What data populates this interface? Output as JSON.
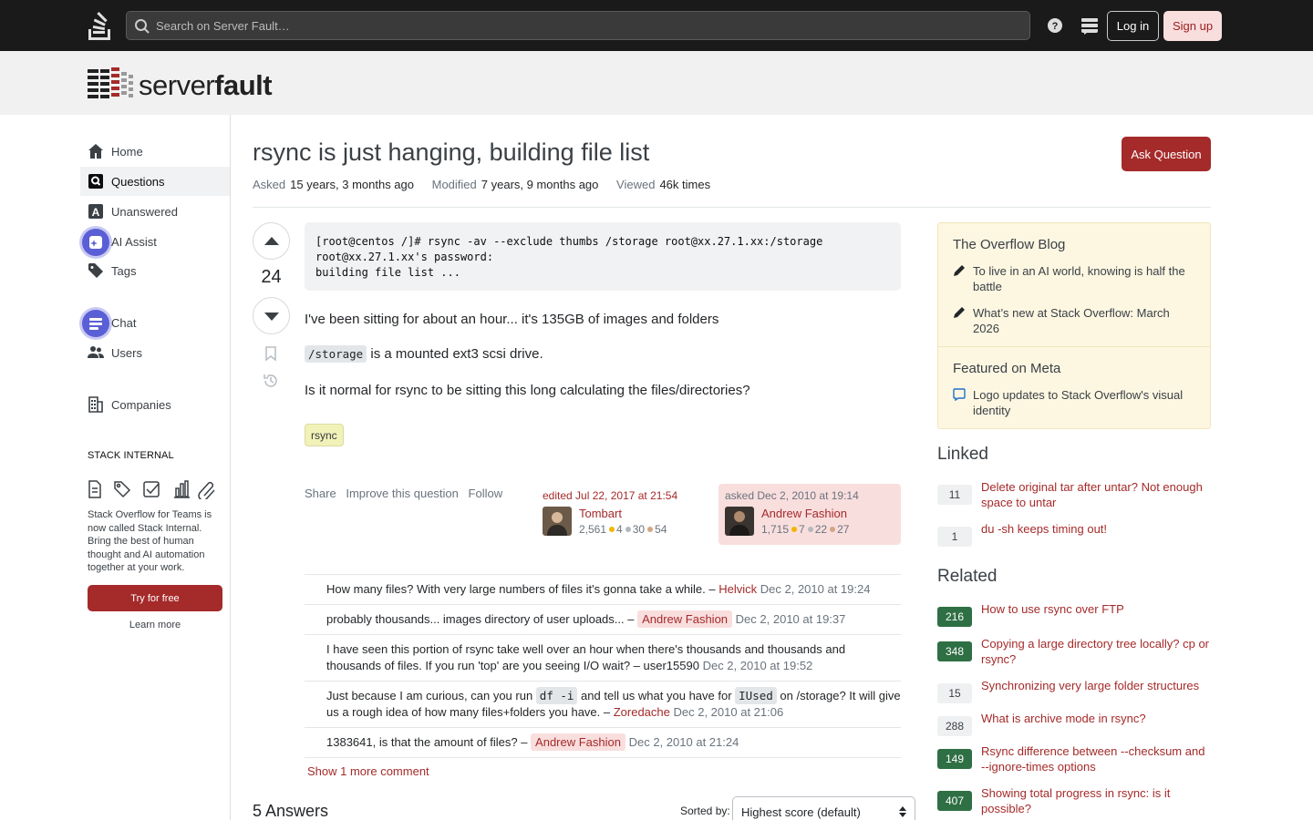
{
  "topbar": {
    "search_placeholder": "Search on Server Fault…",
    "login_label": "Log in",
    "signup_label": "Sign up",
    "icons": [
      "stackoverflow-logo-icon",
      "search-icon",
      "help-icon",
      "site-switcher-icon"
    ]
  },
  "brand": {
    "name_light": "server",
    "name_bold": "fault"
  },
  "nav": {
    "items": [
      {
        "label": "Home",
        "icon": "home-icon"
      },
      {
        "label": "Questions",
        "icon": "questions-icon",
        "active": true
      },
      {
        "label": "Unanswered",
        "icon": "unanswered-icon"
      },
      {
        "label": "AI Assist",
        "icon": "ai-assist-icon"
      },
      {
        "label": "Tags",
        "icon": "tag-icon"
      },
      {
        "label": "Chat",
        "icon": "chat-icon"
      },
      {
        "label": "Users",
        "icon": "users-icon"
      },
      {
        "label": "Companies",
        "icon": "companies-icon"
      }
    ],
    "stack_internal": {
      "heading": "STACK INTERNAL",
      "text": "Stack Overflow for Teams is now called Stack Internal. Bring the best of human thought and AI automation together at your work.",
      "try_label": "Try for free",
      "learn_more": "Learn more"
    }
  },
  "question": {
    "title": "rsync is just hanging, building file list",
    "ask_label": "Ask Question",
    "meta": {
      "asked_label": "Asked",
      "asked_value": "15 years, 3 months ago",
      "modified_label": "Modified",
      "modified_value": "7 years, 9 months ago",
      "viewed_label": "Viewed",
      "viewed_value": "46k times"
    },
    "score": "24",
    "code": "[root@centos /]# rsync -av --exclude thumbs /storage root@xx.27.1.xx:/storage\nroot@xx.27.1.xx's password:\nbuilding file list ...",
    "p1": "I've been sitting for about an hour... it's 135GB of images and folders",
    "p2_code": "/storage",
    "p2_text": " is a mounted ext3 scsi drive.",
    "p3": "Is it normal for rsync to be sitting this long calculating the files/directories?",
    "tag": "rsync",
    "actions": {
      "share": "Share",
      "improve": "Improve this question",
      "follow": "Follow"
    },
    "editor": {
      "title": "edited Jul 22, 2017 at 21:54",
      "name": "Tombart",
      "rep": "2,561",
      "gold": "4",
      "silver": "30",
      "bronze": "54"
    },
    "asker": {
      "title": "asked Dec 2, 2010 at 19:14",
      "name": "Andrew Fashion",
      "rep": "1,715",
      "gold": "7",
      "silver": "22",
      "bronze": "27"
    }
  },
  "comments": [
    {
      "text": "How many files? With very large numbers of files it's gonna take a while. – ",
      "user": "Helvick",
      "date": "Dec 2, 2010 at 19:24"
    },
    {
      "text": "probably thousands... images directory of user uploads... – ",
      "user": "Andrew Fashion",
      "date": "Dec 2, 2010 at 19:37"
    },
    {
      "text": "I have seen this portion of rsync take well over an hour when there's thousands and thousands and thousands of files. If you run 'top' are you seeing I/O wait? – ",
      "user": "user15590",
      "date": "Dec 2, 2010 at 19:52"
    },
    {
      "text_a": "Just because I am curious, can you run ",
      "code_a": "df -i",
      "text_b": " and tell us what you have for ",
      "code_b": "IUsed",
      "text_c": " on /storage? It will give us a rough idea of how many files+folders you have. – ",
      "user": "Zoredache",
      "date": "Dec 2, 2010 at 21:06"
    },
    {
      "text": "1383641, is that the amount of files? – ",
      "user": "Andrew Fashion",
      "date": "Dec 2, 2010 at 21:24"
    }
  ],
  "show_more": "Show 1 more comment",
  "answers": {
    "count_label": "5 Answers",
    "sorted_by": "Sorted by:",
    "sort_value": "Highest score (default)"
  },
  "sidebar": {
    "blog_heading": "The Overflow Blog",
    "blog_items": [
      "To live in an AI world, knowing is half the battle",
      "What’s new at Stack Overflow: March 2026"
    ],
    "meta_heading": "Featured on Meta",
    "meta_items": [
      "Logo updates to Stack Overflow's visual identity"
    ],
    "linked_heading": "Linked",
    "linked": [
      {
        "count": "11",
        "title": "Delete original tar after untar? Not enough space to untar",
        "accepted": false
      },
      {
        "count": "1",
        "title": "du -sh keeps timing out!",
        "accepted": false
      }
    ],
    "related_heading": "Related",
    "related": [
      {
        "count": "216",
        "title": "How to use rsync over FTP",
        "accepted": true
      },
      {
        "count": "348",
        "title": "Copying a large directory tree locally? cp or rsync?",
        "accepted": true
      },
      {
        "count": "15",
        "title": "Synchronizing very large folder structures",
        "accepted": false
      },
      {
        "count": "288",
        "title": "What is archive mode in rsync?",
        "accepted": false
      },
      {
        "count": "149",
        "title": "Rsync difference between --checksum and --ignore-times options",
        "accepted": true
      },
      {
        "count": "407",
        "title": "Showing total progress in rsync: is it possible?",
        "accepted": true
      }
    ]
  },
  "colors": {
    "brand": "#a52a2a",
    "accepted": "#2f6f44",
    "blog_bg": "#fdf7e2",
    "op_highlight": "#f9dede"
  }
}
